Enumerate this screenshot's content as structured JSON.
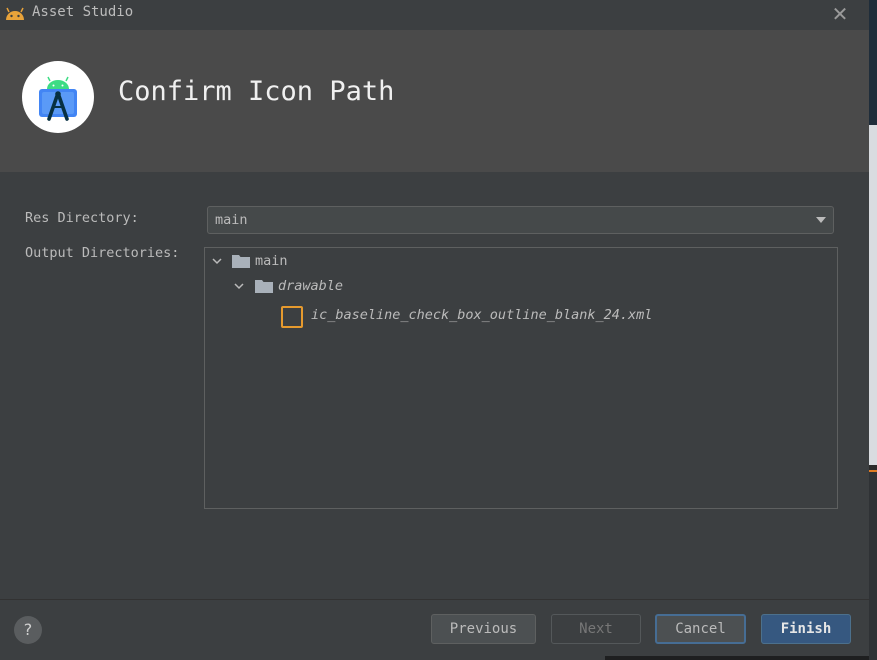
{
  "window": {
    "title": "Asset Studio",
    "close_glyph": "✕",
    "title_icon": "android-icon"
  },
  "banner": {
    "title": "Confirm Icon Path",
    "logo": "android-studio-logo"
  },
  "form": {
    "res_directory_label": "Res Directory:",
    "res_directory_value": "main",
    "output_directories_label": "Output Directories:"
  },
  "tree": {
    "root": "main",
    "child": "drawable",
    "file": "ic_baseline_check_box_outline_blank_24.xml"
  },
  "buttons": {
    "help": "?",
    "previous": "Previous",
    "next": "Next",
    "cancel": "Cancel",
    "finish": "Finish"
  },
  "colors": {
    "background": "#3c3f41",
    "banner": "#4a4a4a",
    "accent": "#365880",
    "file_icon": "#e69a2e",
    "android_green": "#3ddc84"
  }
}
